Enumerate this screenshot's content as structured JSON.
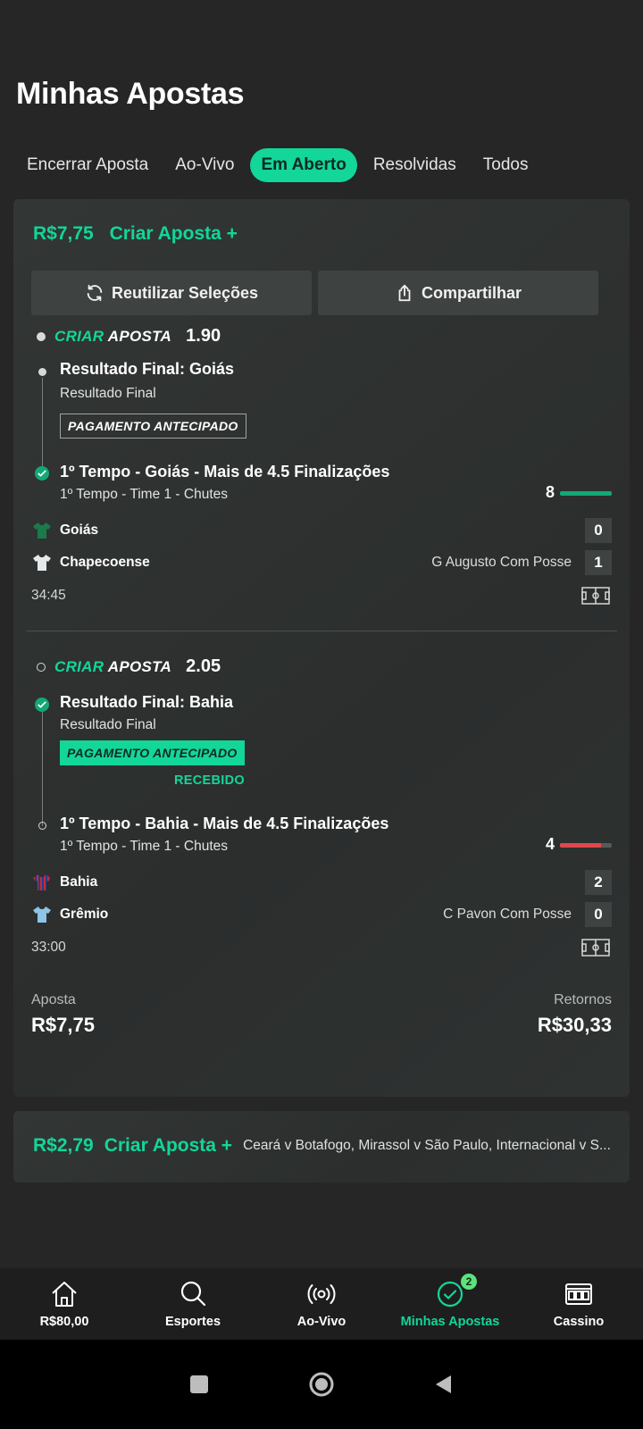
{
  "page": {
    "title": "Minhas Apostas"
  },
  "tabs": [
    {
      "label": "Encerrar Aposta",
      "active": false
    },
    {
      "label": "Ao-Vivo",
      "active": false
    },
    {
      "label": "Em Aberto",
      "active": true
    },
    {
      "label": "Resolvidas",
      "active": false
    },
    {
      "label": "Todos",
      "active": false
    }
  ],
  "bet_card": {
    "amount": "R$7,75",
    "cta": "Criar Aposta +",
    "reuse_label": "Reutilizar Seleções",
    "share_label": "Compartilhar",
    "legs": [
      {
        "brand_a": "CRIAR",
        "brand_b": "APOSTA",
        "odds": "1.90",
        "selections": [
          {
            "title": "Resultado Final: Goiás",
            "subtitle": "Resultado Final",
            "badge": "PAGAMENTO ANTECIPADO"
          },
          {
            "title": "1º Tempo - Goiás - Mais de 4.5 Finalizações",
            "subtitle": "1º Tempo - Time 1 - Chutes",
            "stat": "8",
            "stat_progress": 1.0,
            "stat_color": "#13a877"
          }
        ],
        "teams": [
          {
            "name": "Goiás",
            "score": "0",
            "possession": ""
          },
          {
            "name": "Chapecoense",
            "score": "1",
            "possession": "G Augusto Com Posse"
          }
        ],
        "clock": "34:45"
      },
      {
        "brand_a": "CRIAR",
        "brand_b": "APOSTA",
        "odds": "2.05",
        "selections": [
          {
            "title": "Resultado Final: Bahia",
            "subtitle": "Resultado Final",
            "badge": "PAGAMENTO ANTECIPADO",
            "received": "RECEBIDO"
          },
          {
            "title": "1º Tempo - Bahia - Mais de 4.5 Finalizações",
            "subtitle": "1º Tempo - Time 1 - Chutes",
            "stat": "4",
            "stat_progress": 0.8,
            "stat_color": "#e0474c"
          }
        ],
        "teams": [
          {
            "name": "Bahia",
            "score": "2",
            "possession": ""
          },
          {
            "name": "Grêmio",
            "score": "0",
            "possession": "C Pavon Com Posse"
          }
        ],
        "clock": "33:00"
      }
    ],
    "stake_label": "Aposta",
    "stake_value": "R$7,75",
    "returns_label": "Retornos",
    "returns_value": "R$30,33"
  },
  "second_card": {
    "amount": "R$2,79",
    "cta": "Criar Aposta +",
    "events": "Ceará v Botafogo, Mirassol v São Paulo, Internacional v S..."
  },
  "bottom_nav": [
    {
      "label": "R$80,00",
      "icon": "home-icon",
      "active": false
    },
    {
      "label": "Esportes",
      "icon": "search-icon",
      "active": false
    },
    {
      "label": "Ao-Vivo",
      "icon": "live-icon",
      "active": false
    },
    {
      "label": "Minhas Apostas",
      "icon": "check-circle-icon",
      "active": true,
      "badge": "2"
    },
    {
      "label": "Cassino",
      "icon": "slot-machine-icon",
      "active": false
    }
  ],
  "colors": {
    "accent": "#13d699",
    "background": "#262626",
    "card": "#323634"
  }
}
